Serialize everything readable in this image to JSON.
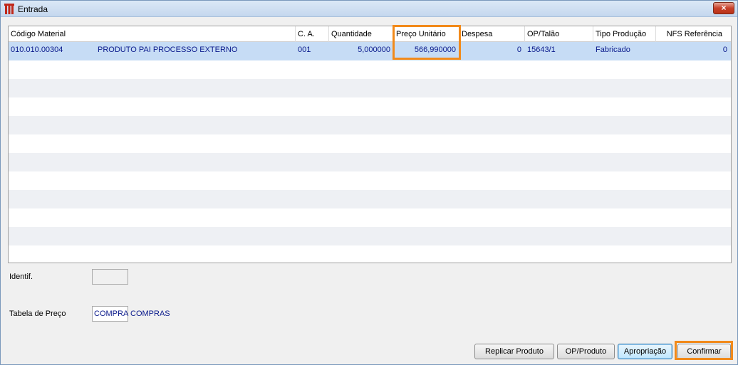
{
  "window": {
    "title": "Entrada",
    "close_label": "×"
  },
  "grid": {
    "columns": [
      "Código Material",
      "C. A.",
      "Quantidade",
      "Preço Unitário",
      "Despesa",
      "OP/Talão",
      "Tipo Produção",
      "NFS Referência"
    ],
    "rows": [
      {
        "codigo": "010.010.00304",
        "descricao": "PRODUTO PAI PROCESSO EXTERNO",
        "ca": "001",
        "quantidade": "5,000000",
        "preco": "566,990000",
        "despesa": "0",
        "op_talao": "15643/1",
        "tipo_producao": "Fabricado",
        "nfs_referencia": "0"
      }
    ]
  },
  "form": {
    "identif_label": "Identif.",
    "identif_value": "",
    "tabela_label": "Tabela de Preço",
    "tabela_value": "COMPRA",
    "tabela_desc": "COMPRAS"
  },
  "buttons": {
    "replicar": "Replicar Produto",
    "op_produto": "OP/Produto",
    "apropriacao": "Apropriação",
    "confirmar": "Confirmar"
  },
  "colors": {
    "highlight": "#f28a1a",
    "selected_row": "#c6dcf5",
    "text_blue": "#0a1a8c"
  }
}
